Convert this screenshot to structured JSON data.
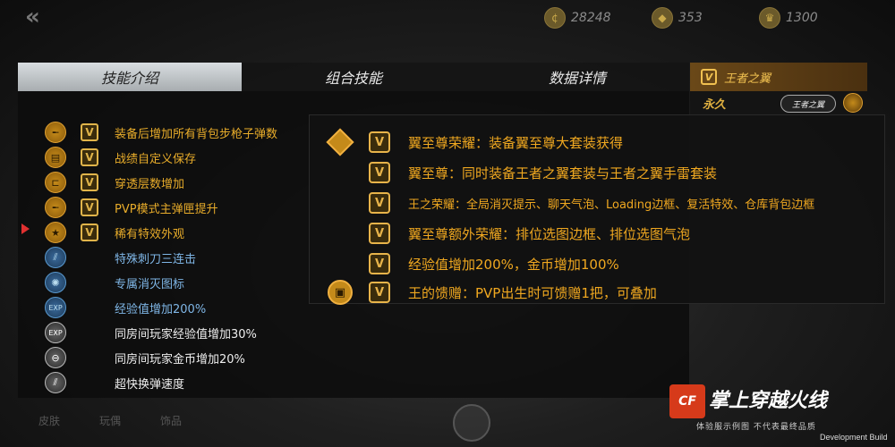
{
  "topbar": {
    "currencies": [
      {
        "icon": "coin-icon",
        "value": "28248"
      },
      {
        "icon": "diamond-icon",
        "value": "353"
      },
      {
        "icon": "crown-icon",
        "value": "1300"
      }
    ]
  },
  "tabs": [
    {
      "label": "技能介绍",
      "active": true
    },
    {
      "label": "组合技能",
      "active": false
    },
    {
      "label": "数据详情",
      "active": false
    }
  ],
  "side": {
    "header": "王者之翼",
    "duration": "永久",
    "emblem": "王者之翼"
  },
  "skills": [
    {
      "icon": "rifle-icon",
      "tier": "gold",
      "v": true,
      "text": "装备后增加所有背包步枪子弹数"
    },
    {
      "icon": "record-icon",
      "tier": "gold",
      "v": true,
      "text": "战绩自定义保存"
    },
    {
      "icon": "penetration-icon",
      "tier": "gold",
      "v": true,
      "text": "穿透层数增加"
    },
    {
      "icon": "magazine-icon",
      "tier": "gold",
      "v": true,
      "text": "PVP模式主弹匣提升"
    },
    {
      "icon": "star-icon",
      "tier": "gold",
      "v": true,
      "text": "稀有特效外观"
    },
    {
      "icon": "knife-icon",
      "tier": "blue",
      "v": false,
      "text": "特殊刺刀三连击"
    },
    {
      "icon": "kill-icon",
      "tier": "blue",
      "v": false,
      "text": "专属消灭图标"
    },
    {
      "icon": "exp-icon",
      "tier": "blue",
      "v": false,
      "text": "经验值增加200%"
    },
    {
      "icon": "room-exp-icon",
      "tier": "white",
      "v": false,
      "text": "同房间玩家经验值增加30%"
    },
    {
      "icon": "room-gold-icon",
      "tier": "white",
      "v": false,
      "text": "同房间玩家金币增加20%"
    },
    {
      "icon": "reload-icon",
      "tier": "white",
      "v": false,
      "text": "超快换弹速度"
    }
  ],
  "popup": {
    "rows": [
      {
        "icon": "diamond-badge-icon",
        "text": "翼至尊荣耀：装备翼至尊大套装获得",
        "small": false
      },
      {
        "icon": "",
        "text": "翼至尊：同时装备王者之翼套装与王者之翼手雷套装",
        "small": false
      },
      {
        "icon": "",
        "text": "王之荣耀：全局消灭提示、聊天气泡、Loading边框、复活特效、仓库背包边框",
        "small": true
      },
      {
        "icon": "",
        "text": "翼至尊额外荣耀：排位选图边框、排位选图气泡",
        "small": false
      },
      {
        "icon": "",
        "text": "经验值增加200%，金币增加100%",
        "small": false
      },
      {
        "icon": "gift-icon",
        "text": "王的馈赠：PVP出生时可馈赠1把，可叠加",
        "small": false
      }
    ]
  },
  "bottom_tabs": [
    "皮肤",
    "玩偶",
    "饰品"
  ],
  "watermark": {
    "mark": "CF",
    "title": "掌上穿越火线",
    "subtitle": "体验服示例图 不代表最终品质",
    "build": "Development Build"
  },
  "colors": {
    "gold_text": "#e8ac2a",
    "blue_text": "#7fb6e6",
    "tab_active_bg": "#d8dde0",
    "brand_red": "#d63a1a"
  }
}
